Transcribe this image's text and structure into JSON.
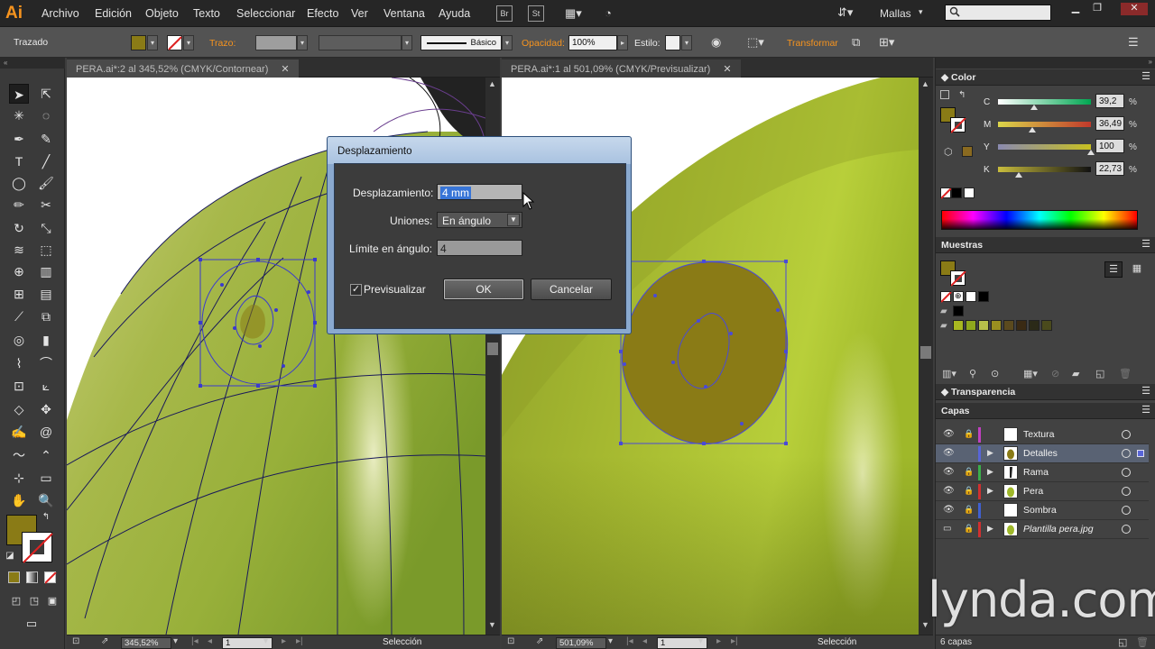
{
  "app": {
    "logo": "Ai"
  },
  "menu": [
    "Archivo",
    "Edición",
    "Objeto",
    "Texto",
    "Seleccionar",
    "Efecto",
    "Ver",
    "Ventana",
    "Ayuda"
  ],
  "bridge_buttons": [
    "Br",
    "St"
  ],
  "workspace": {
    "label": "Mallas"
  },
  "search": {
    "placeholder": "",
    "icon": "search-icon"
  },
  "control_bar": {
    "selection_type": "Trazado",
    "fill_color": "#8a7b16",
    "stroke_label": "Trazo:",
    "stroke_style_label": "Básico",
    "opacity_label": "Opacidad:",
    "opacity_value": "100%",
    "style_label": "Estilo:",
    "transform_label": "Transformar"
  },
  "documents": [
    {
      "tab": "PERA.ai*:2 al 345,52% (CMYK/Contornear)",
      "zoom": "345,52%",
      "page": "1",
      "status": "Selección"
    },
    {
      "tab": "PERA.ai*:1 al 501,09% (CMYK/Previsualizar)",
      "zoom": "501,09%",
      "page": "1",
      "status": "Selección"
    }
  ],
  "dialog": {
    "title": "Desplazamiento",
    "offset_label": "Desplazamiento:",
    "offset_value": "4 mm",
    "joins_label": "Uniones:",
    "joins_value": "En ángulo",
    "miter_label": "Límite en ángulo:",
    "miter_value": "4",
    "preview_label": "Previsualizar",
    "preview_checked": true,
    "ok_label": "OK",
    "cancel_label": "Cancelar"
  },
  "color_panel": {
    "title": "Color",
    "fill_color": "#8a7b16",
    "channels": [
      {
        "label": "C",
        "value": "39,2",
        "fraction": 0.392,
        "gradient": [
          "#ffffff",
          "#00a651"
        ]
      },
      {
        "label": "M",
        "value": "36,49",
        "fraction": 0.3649,
        "gradient": [
          "#dcd64a",
          "#c0392b"
        ]
      },
      {
        "label": "Y",
        "value": "100",
        "fraction": 1.0,
        "gradient": [
          "#8a8ab0",
          "#c8c020"
        ]
      },
      {
        "label": "K",
        "value": "22,73",
        "fraction": 0.2273,
        "gradient": [
          "#c9bd3d",
          "#111111"
        ]
      }
    ],
    "percent_sign": "%"
  },
  "swatches_panel": {
    "title": "Muestras",
    "row1": [
      "#ffffff",
      "#000000"
    ],
    "row2": [
      "#000000"
    ],
    "row3": [
      "#a8b820",
      "#8fa81c",
      "#b7c04a",
      "#9a8f20",
      "#5b4a1e",
      "#3a2a14",
      "#2b2a18",
      "#4a4a1c"
    ]
  },
  "transparency_panel": {
    "title": "Transparencia"
  },
  "layers_panel": {
    "title": "Capas",
    "count": "6 capas",
    "layers": [
      {
        "name": "Textura",
        "color": "#c040c0",
        "selected": false,
        "expandable": false
      },
      {
        "name": "Detalles",
        "color": "#5865d8",
        "selected": true,
        "expandable": true
      },
      {
        "name": "Rama",
        "color": "#3ab04a",
        "selected": false,
        "expandable": true
      },
      {
        "name": "Pera",
        "color": "#d03030",
        "selected": false,
        "expandable": true
      },
      {
        "name": "Sombra",
        "color": "#4060d0",
        "selected": false,
        "expandable": false
      },
      {
        "name": "Plantilla pera.jpg",
        "color": "#d03030",
        "selected": false,
        "expandable": true
      }
    ]
  },
  "toolbox": {
    "fill_color": "#8a7b16"
  },
  "watermark": "lynda.com"
}
